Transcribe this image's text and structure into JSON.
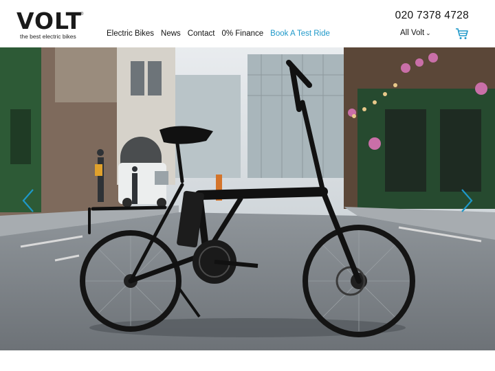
{
  "brand": {
    "logo_text": "VOLT",
    "tagline": "the best electric bikes",
    "trademark": "®"
  },
  "nav": {
    "items": [
      "Electric Bikes",
      "News",
      "Contact",
      "0% Finance"
    ],
    "cta": "Book A Test Ride"
  },
  "header": {
    "phone": "020 7378 4728",
    "language": "All Volt",
    "language_chevron": "⌄"
  },
  "hero": {
    "image": "black folding electric bike on a city street",
    "prev_icon": "chevron-left-icon",
    "next_icon": "chevron-right-icon"
  },
  "colors": {
    "accent": "#1e98c9",
    "text": "#111111",
    "background": "#ffffff"
  }
}
